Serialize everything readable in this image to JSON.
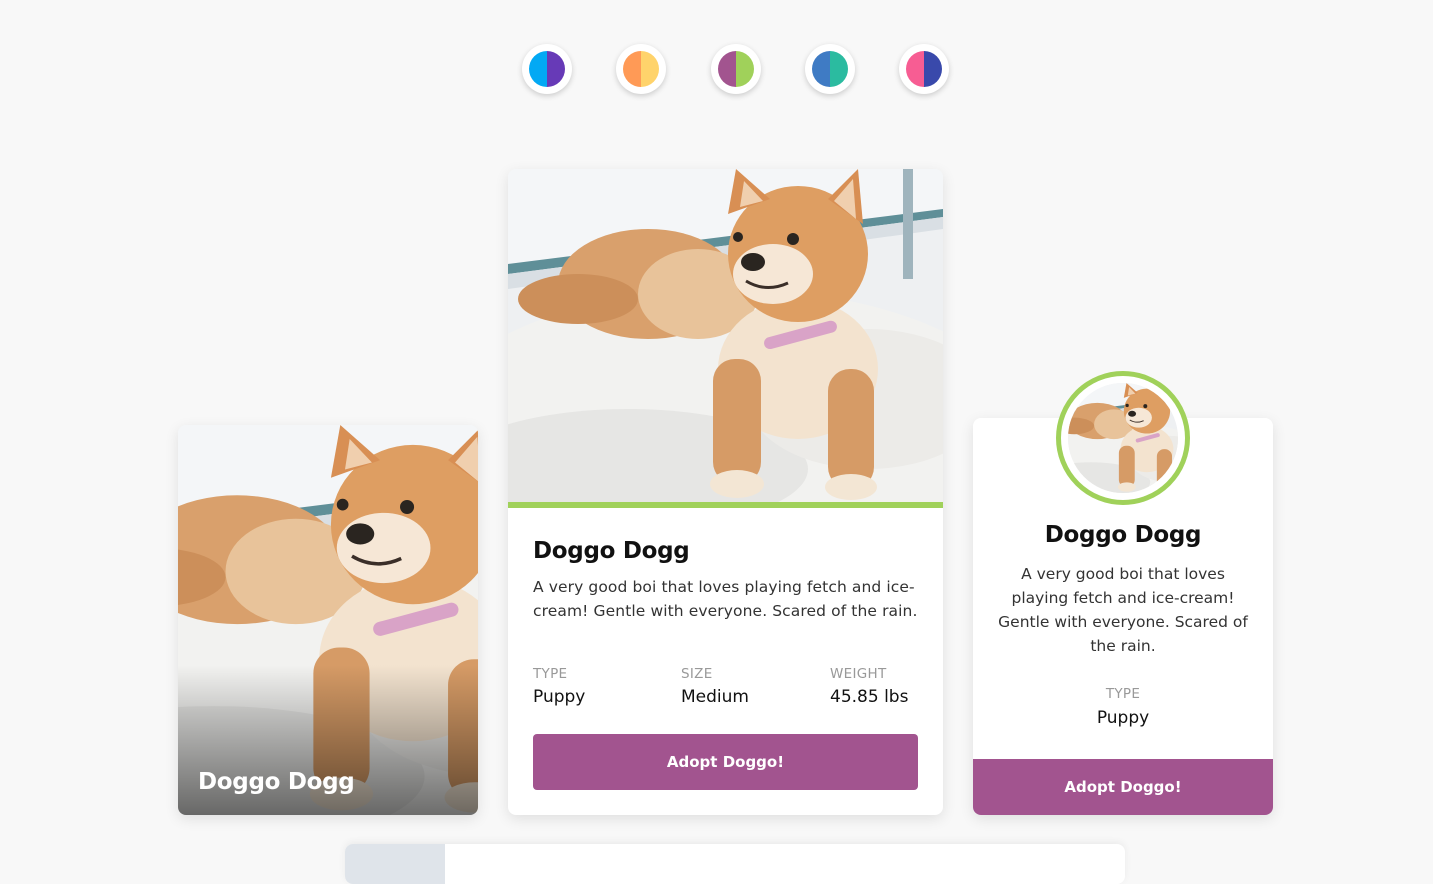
{
  "theme_swatches": [
    {
      "name": "blue-purple",
      "left": "#03a9f4",
      "right": "#673ab7"
    },
    {
      "name": "orange-yellow",
      "left": "#ff9a56",
      "right": "#ffd36b"
    },
    {
      "name": "purple-green",
      "left": "#a2548f",
      "right": "#a0d15a"
    },
    {
      "name": "blue-teal",
      "left": "#3f7bc4",
      "right": "#2bbba0"
    },
    {
      "name": "pink-indigo",
      "left": "#f75d93",
      "right": "#3949ab"
    }
  ],
  "colors": {
    "accent": "#a2548f",
    "highlight": "#a0d15a",
    "background": "#f8f8f8"
  },
  "card_overlay": {
    "title": "Doggo Dogg",
    "image": "shiba-puppy-photo"
  },
  "card_detailed": {
    "title": "Doggo Dogg",
    "description": "A very good boi that loves playing fetch and ice-cream! Gentle with everyone. Scared of the rain.",
    "stats": [
      {
        "label": "TYPE",
        "value": "Puppy"
      },
      {
        "label": "SIZE",
        "value": "Medium"
      },
      {
        "label": "WEIGHT",
        "value": "45.85 lbs"
      }
    ],
    "button_label": "Adopt Doggo!",
    "image": "shiba-puppy-photo"
  },
  "card_profile": {
    "title": "Doggo Dogg",
    "description": "A very good boi that loves playing fetch and ice-cream! Gentle with everyone. Scared of the rain.",
    "stat": {
      "label": "TYPE",
      "value": "Puppy"
    },
    "button_label": "Adopt Doggo!",
    "image": "shiba-puppy-photo"
  }
}
